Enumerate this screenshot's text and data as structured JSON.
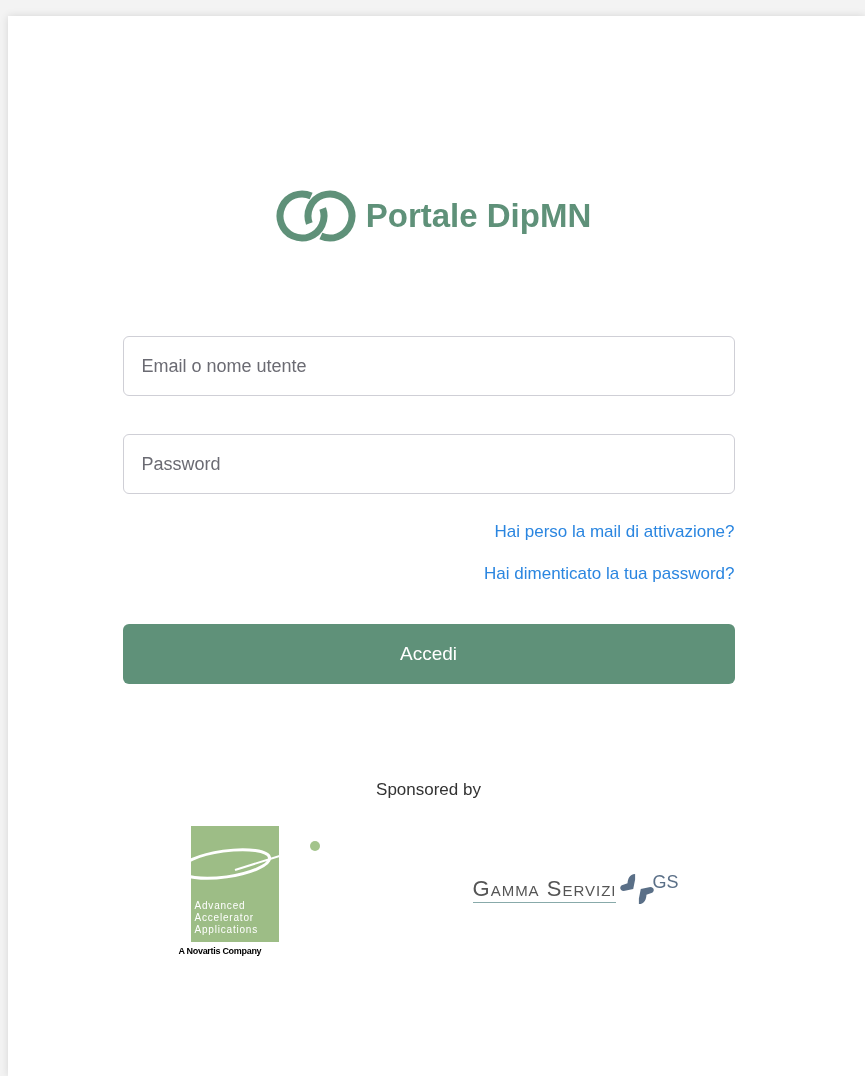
{
  "brand": {
    "title": "Portale DipMN"
  },
  "fields": [
    {
      "placeholder": "Email o nome utente"
    },
    {
      "placeholder": "Password"
    }
  ],
  "links": [
    "Hai perso la mail di attivazione?",
    "Hai dimenticato la tua password?"
  ],
  "submit": "Accedi",
  "sponsors": {
    "heading": "Sponsored by",
    "aaa": {
      "lines": [
        "Advanced",
        "Accelerator",
        "Applications"
      ],
      "tagline": "A Novartis Company"
    },
    "gamma": {
      "name": "Gamma Servizi",
      "mark": "GS"
    }
  }
}
